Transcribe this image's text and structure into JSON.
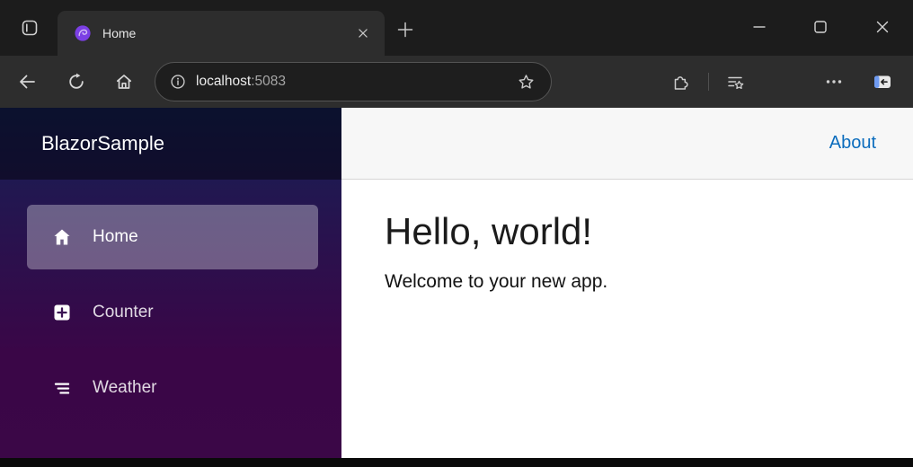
{
  "browser": {
    "tab": {
      "title": "Home"
    },
    "address_bar": {
      "host": "localhost",
      "port": ":5083"
    },
    "icons": {
      "tab_actions": "tab-actions-rounded-square",
      "tab_favicon": "blazor-purple-swirl-logo",
      "tab_close": "x-cross",
      "new_tab": "plus",
      "minimize": "horizontal-line",
      "maximize": "square-outline",
      "close": "x-cross",
      "back": "arrow-left",
      "refresh": "circular-arrow",
      "home": "house-outline",
      "site_info": "info-circle",
      "favorite": "star-outline",
      "extensions": "puzzle-piece",
      "favorites_hub": "lines-with-star",
      "more": "three-dots",
      "sidebar_toggle": "panel-with-left-arrow"
    }
  },
  "app": {
    "brand": "BlazorSample",
    "nav": [
      {
        "label": "Home",
        "icon": "house-icon",
        "active": true
      },
      {
        "label": "Counter",
        "icon": "plus-square-icon",
        "active": false
      },
      {
        "label": "Weather",
        "icon": "list-icon",
        "active": false
      }
    ],
    "header": {
      "about": "About"
    },
    "content": {
      "heading": "Hello, world!",
      "welcome": "Welcome to your new app."
    },
    "colors": {
      "link_blue": "#0b6cbd",
      "sidebar_gradient_top": "#152055",
      "sidebar_gradient_bottom": "#3a0647",
      "active_item_overlay": "rgba(255,255,255,0.32)",
      "top_row_bg": "#f7f7f7"
    }
  }
}
